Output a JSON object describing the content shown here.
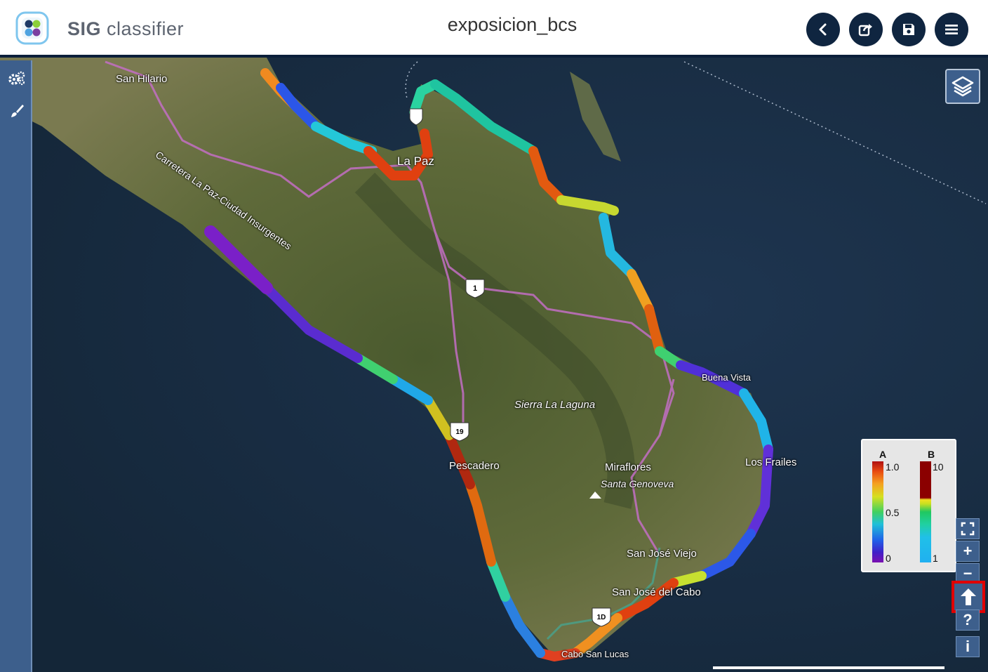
{
  "header": {
    "app_name_bold": "SIG",
    "app_name_rest": "classifier",
    "title": "exposicion_bcs",
    "buttons": [
      {
        "name": "back-button",
        "icon": "chevron-left-icon"
      },
      {
        "name": "share-button",
        "icon": "share-icon"
      },
      {
        "name": "save-button",
        "icon": "floppy-disk-icon"
      },
      {
        "name": "menu-button",
        "icon": "hamburger-menu-icon"
      }
    ]
  },
  "left_toolbar": [
    {
      "name": "settings-tool",
      "icon": "gears-icon"
    },
    {
      "name": "style-tool",
      "icon": "paintbrush-icon"
    }
  ],
  "map": {
    "places": {
      "san_hilario": "San Hilario",
      "carretera": "Carretera La Paz-Ciudad Insurgentes",
      "la_paz": "La Paz",
      "sierra": "Sierra La Laguna",
      "pescadero": "Pescadero",
      "miraflores": "Miraflores",
      "santa_genoveva": "Santa Genoveva",
      "los_frailes": "Los Frailes",
      "buena_vista": "Buena Vista",
      "sj_viejo": "San José Viejo",
      "sj_cabo": "San José del Cabo",
      "cabo": "Cabo San Lucas"
    },
    "shields": {
      "h1": "1",
      "h19": "19",
      "h1d": "1D"
    }
  },
  "legend": {
    "a_label": "A",
    "a_max": "1.0",
    "a_mid": "0.5",
    "a_min": "0",
    "b_label": "B",
    "b_max": "10",
    "b_min": "1"
  },
  "controls": {
    "fullscreen": "fullscreen-icon",
    "zoom_in": "+",
    "zoom_out": "−",
    "north": "north-arrow-icon",
    "help": "?",
    "info": "i"
  },
  "colors": {
    "header_bg": "#ffffff",
    "navy": "#0f2540",
    "toolbar_blue": "#3d5f8c",
    "highlight_red": "#e00000"
  }
}
